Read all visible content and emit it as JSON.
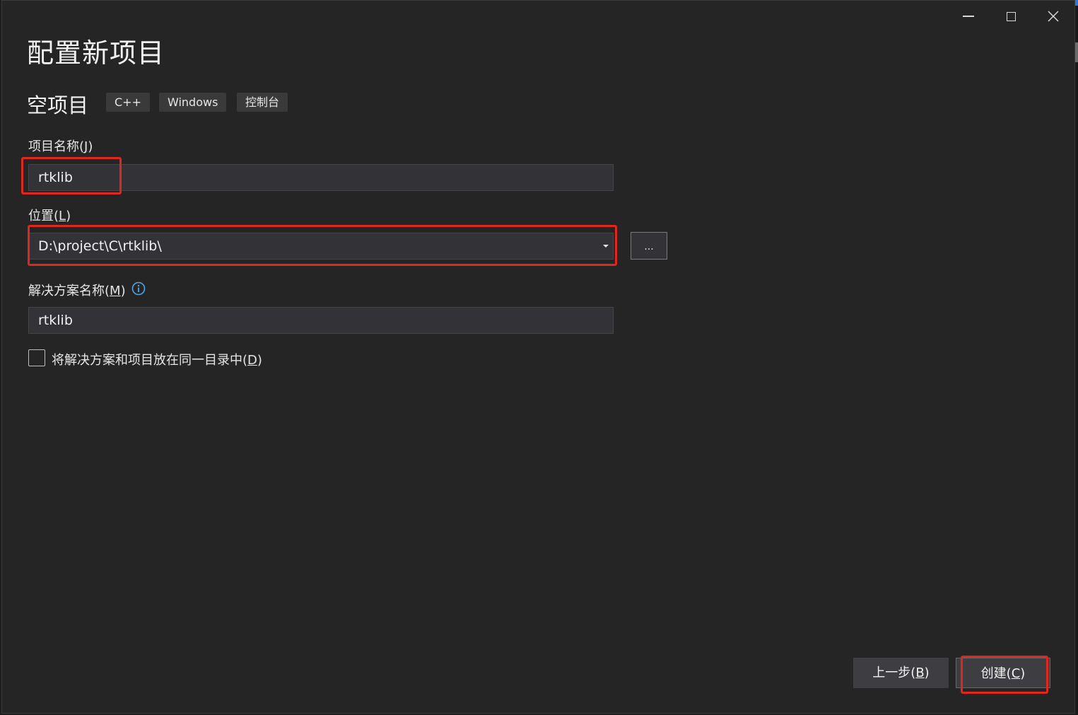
{
  "window": {
    "title": "配置新项目",
    "controls": {
      "minimize": "minimize-icon",
      "maximize": "maximize-icon",
      "close": "close-icon"
    }
  },
  "template": {
    "name": "空项目",
    "tags": [
      "C++",
      "Windows",
      "控制台"
    ]
  },
  "form": {
    "project_name": {
      "label": "项目名称",
      "mnemonic": "J",
      "value": "rtklib"
    },
    "location": {
      "label": "位置",
      "mnemonic": "L",
      "value": "D:\\project\\C\\rtklib\\",
      "browse_label": "..."
    },
    "solution_name": {
      "label": "解决方案名称",
      "mnemonic": "M",
      "value": "rtklib",
      "info_icon": "info-icon"
    },
    "same_dir": {
      "label": "将解决方案和项目放在同一目录中",
      "mnemonic": "D",
      "checked": false
    }
  },
  "footer": {
    "back": {
      "label": "上一步",
      "mnemonic": "B"
    },
    "create": {
      "label": "创建",
      "mnemonic": "C"
    }
  },
  "colors": {
    "background": "#252526",
    "field": "#333337",
    "highlight": "#e0261f"
  }
}
